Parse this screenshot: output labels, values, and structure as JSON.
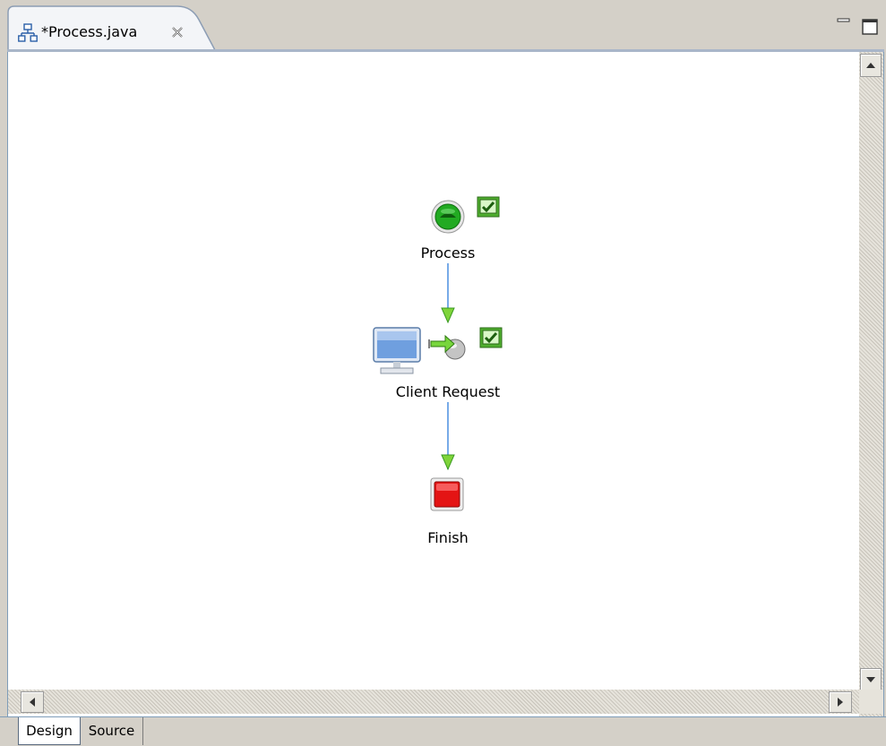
{
  "editor": {
    "tab_title": "*Process.java",
    "tab_icon": "process-diagram-icon",
    "close_icon": "close-icon",
    "minimize_icon": "minimize-icon",
    "maximize_icon": "maximize-icon"
  },
  "diagram": {
    "nodes": [
      {
        "id": "start",
        "label": "Process",
        "icon": "start-node-icon",
        "validated": true
      },
      {
        "id": "client-request",
        "label": "Client Request",
        "icon": "client-request-icon",
        "validated": true
      },
      {
        "id": "finish",
        "label": "Finish",
        "icon": "stop-node-icon"
      }
    ],
    "connections": [
      {
        "from": "start",
        "to": "client-request"
      },
      {
        "from": "client-request",
        "to": "finish"
      }
    ],
    "colors": {
      "connection": "#4a8fe0",
      "arrowhead": "#7fd43a",
      "start": "#1a9a1a",
      "finish": "#dd1111",
      "validated": "#3c8b22"
    }
  },
  "bottom_tabs": {
    "design": "Design",
    "source": "Source"
  }
}
